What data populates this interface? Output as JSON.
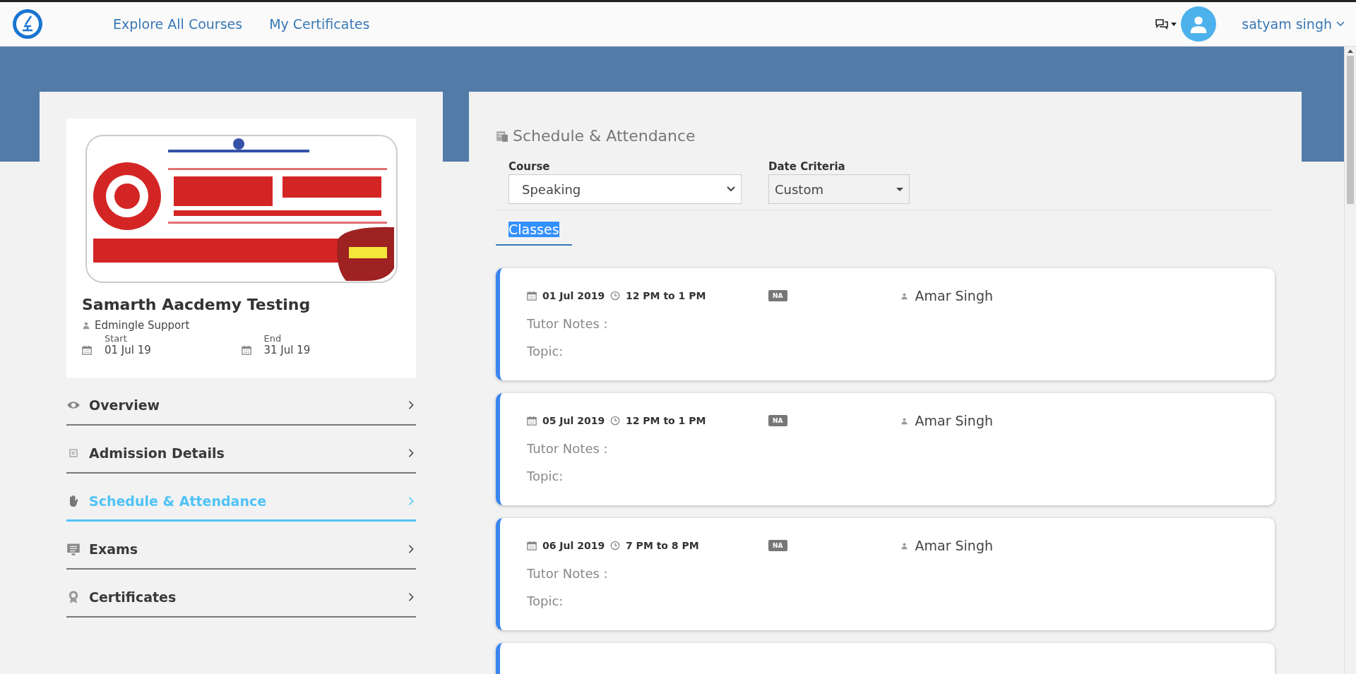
{
  "header": {
    "nav": [
      {
        "label": "Explore All Courses"
      },
      {
        "label": "My Certificates"
      }
    ],
    "user": "satyam singh"
  },
  "course": {
    "title": "Samarth Aacdemy Testing",
    "instructor": "Edmingle Support",
    "start_label": "Start",
    "start": "01 Jul 19",
    "end_label": "End",
    "end": "31 Jul 19"
  },
  "menu": [
    {
      "label": "Overview",
      "selected": false
    },
    {
      "label": "Admission Details",
      "selected": false
    },
    {
      "label": "Schedule & Attendance",
      "selected": true
    },
    {
      "label": "Exams",
      "selected": false
    },
    {
      "label": "Certificates",
      "selected": false
    }
  ],
  "section": {
    "title": "Schedule & Attendance",
    "filters": [
      {
        "label": "Course",
        "value": "Speaking",
        "kind": "native"
      },
      {
        "label": "Date Criteria",
        "value": "Custom",
        "kind": "caret"
      }
    ],
    "tabs": [
      {
        "label": "Classes",
        "selected": true
      }
    ],
    "classes": [
      {
        "kind": "full",
        "date": "01 Jul 2019",
        "time": "12 PM to 1 PM",
        "badge": "NA",
        "tutor": "Amar Singh",
        "notes_label": "Tutor Notes :",
        "topic_label": "Topic:"
      },
      {
        "kind": "full",
        "date": "05 Jul 2019",
        "time": "12 PM to 1 PM",
        "badge": "NA",
        "tutor": "Amar Singh",
        "notes_label": "Tutor Notes :",
        "topic_label": "Topic:"
      },
      {
        "kind": "full",
        "date": "06 Jul 2019",
        "time": "7 PM to 8 PM",
        "badge": "NA",
        "tutor": "Amar Singh",
        "notes_label": "Tutor Notes :",
        "topic_label": "Topic:"
      },
      {
        "kind": "partial"
      }
    ]
  }
}
